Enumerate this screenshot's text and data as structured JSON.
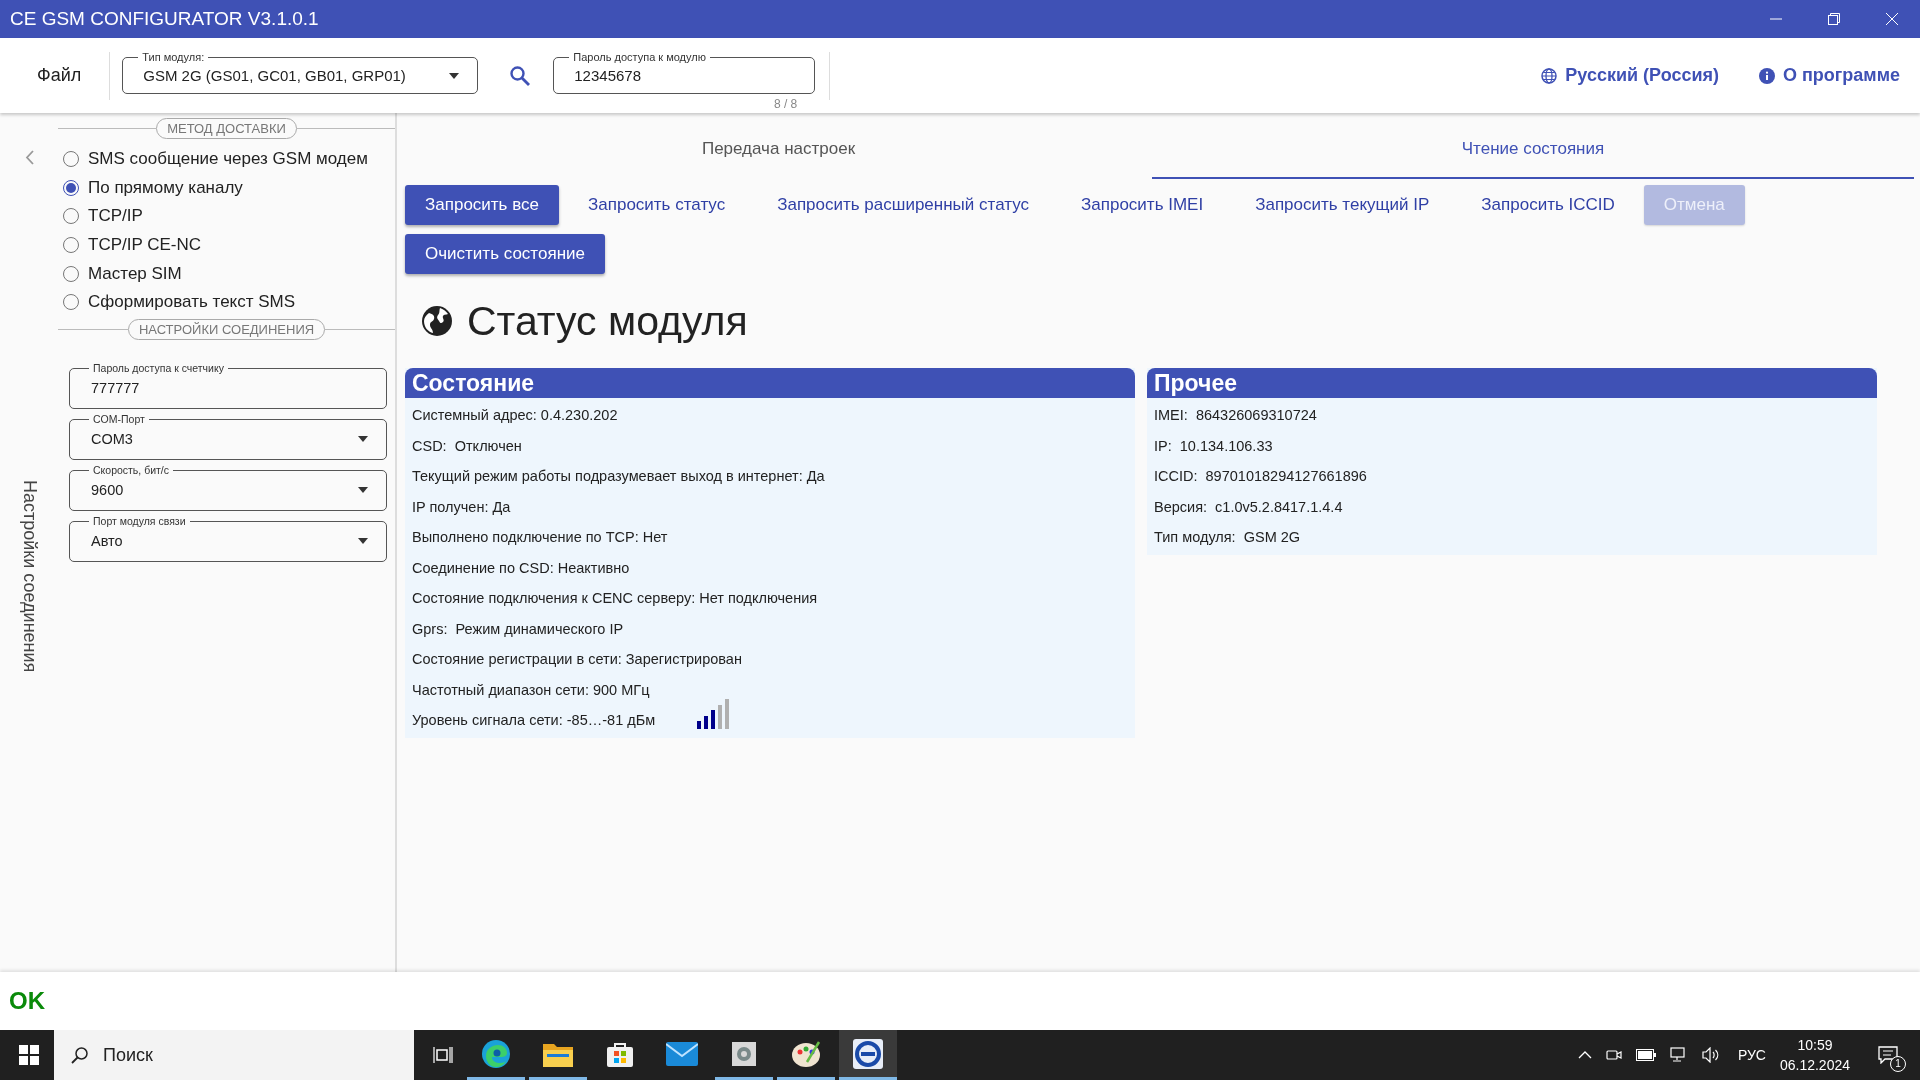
{
  "window": {
    "title": "CE GSM CONFIGURATOR V3.1.0.1"
  },
  "toolbar": {
    "file_menu": "Файл",
    "module_type": {
      "label": "Тип модуля:",
      "value": "GSM 2G (GS01, GC01, GB01, GRP01)"
    },
    "password": {
      "label": "Пароль доступа к модулю",
      "value": "12345678",
      "counter": "8 / 8"
    },
    "language": "Русский (Россия)",
    "about": "О программе"
  },
  "sidebar": {
    "delivery_title": "МЕТОД ДОСТАВКИ",
    "delivery_methods": [
      {
        "label": "SMS сообщение через GSM модем",
        "selected": false
      },
      {
        "label": "По прямому каналу",
        "selected": true
      },
      {
        "label": "TCP/IP",
        "selected": false
      },
      {
        "label": "TCP/IP CE-NC",
        "selected": false
      },
      {
        "label": "Мастер SIM",
        "selected": false
      },
      {
        "label": "Сформировать текст SMS",
        "selected": false
      }
    ],
    "connection_title": "НАСТРОЙКИ СОЕДИНЕНИЯ",
    "fields": [
      {
        "kind": "text",
        "label": "Пароль доступа к счетчику",
        "value": "777777"
      },
      {
        "kind": "select",
        "label": "COM-Порт",
        "value": "COM3"
      },
      {
        "kind": "select",
        "label": "Скорость, бит/с",
        "value": "9600"
      },
      {
        "kind": "select",
        "label": "Порт модуля связи",
        "value": "Авто"
      }
    ],
    "vertical_label": "Настройки соединения"
  },
  "tabs": [
    {
      "label": "Передача настроек",
      "selected": false
    },
    {
      "label": "Чтение состояния",
      "selected": true
    }
  ],
  "action_rows": [
    [
      {
        "label": "Запросить все",
        "kind": "filled",
        "disabled": false
      },
      {
        "label": "Запросить статус",
        "kind": "flat",
        "disabled": false
      },
      {
        "label": "Запросить расширенный статус",
        "kind": "flat",
        "disabled": false
      },
      {
        "label": "Запросить IMEI",
        "kind": "flat",
        "disabled": false
      },
      {
        "label": "Запросить текущий IP",
        "kind": "flat",
        "disabled": false
      },
      {
        "label": "Запросить ICCID",
        "kind": "flat",
        "disabled": false
      },
      {
        "label": "Отмена",
        "kind": "filled",
        "disabled": true
      }
    ],
    [
      {
        "label": "Очистить состояние",
        "kind": "filled",
        "disabled": false
      }
    ]
  ],
  "heading": "Статус модуля",
  "panels": [
    {
      "title": "Состояние",
      "rows": [
        {
          "kind": "text",
          "text": "Системный адрес: 0.4.230.202"
        },
        {
          "kind": "text",
          "text": "CSD:  Отключен"
        },
        {
          "kind": "text",
          "text": "Текущий режим работы подразумевает выход в интернет: Да"
        },
        {
          "kind": "text",
          "text": "IP получен: Да"
        },
        {
          "kind": "text",
          "text": "Выполнено подключение по TCP: Нет"
        },
        {
          "kind": "text",
          "text": "Соединение по CSD: Неактивно"
        },
        {
          "kind": "text",
          "text": "Состояние подключения к CENC серверу: Нет подключения"
        },
        {
          "kind": "text",
          "text": "Gprs:  Режим динамического IP"
        },
        {
          "kind": "text",
          "text": "Состояние регистрации в сети: Зарегистрирован"
        },
        {
          "kind": "text",
          "text": "Частотный диапазон сети: 900 МГц"
        },
        {
          "kind": "signal",
          "text": "Уровень сигнала сети: -85…-81 дБм"
        }
      ]
    },
    {
      "title": "Прочее",
      "rows": [
        {
          "kind": "text",
          "text": "IMEI:  864326069310724"
        },
        {
          "kind": "text",
          "text": "IP:  10.134.106.33"
        },
        {
          "kind": "text",
          "text": "ICCID:  89701018294127661896"
        },
        {
          "kind": "text",
          "text": "Версия:  c1.0v5.2.8417.1.4.4"
        },
        {
          "kind": "text",
          "text": "Тип модуля:  GSM 2G"
        }
      ]
    }
  ],
  "status_bar": {
    "message": "OK"
  },
  "taskbar": {
    "search_placeholder": "Поиск",
    "apps": [
      {
        "kind": "edge",
        "open": true,
        "active": false
      },
      {
        "kind": "folder",
        "open": true,
        "active": false
      },
      {
        "kind": "store",
        "open": false,
        "active": false
      },
      {
        "kind": "mail",
        "open": false,
        "active": false
      },
      {
        "kind": "tool",
        "open": true,
        "active": false
      },
      {
        "kind": "paint",
        "open": true,
        "active": false
      },
      {
        "kind": "gsm",
        "open": true,
        "active": true
      }
    ],
    "language": "РУС",
    "time": "10:59",
    "date": "06.12.2024",
    "notifications": "1"
  }
}
